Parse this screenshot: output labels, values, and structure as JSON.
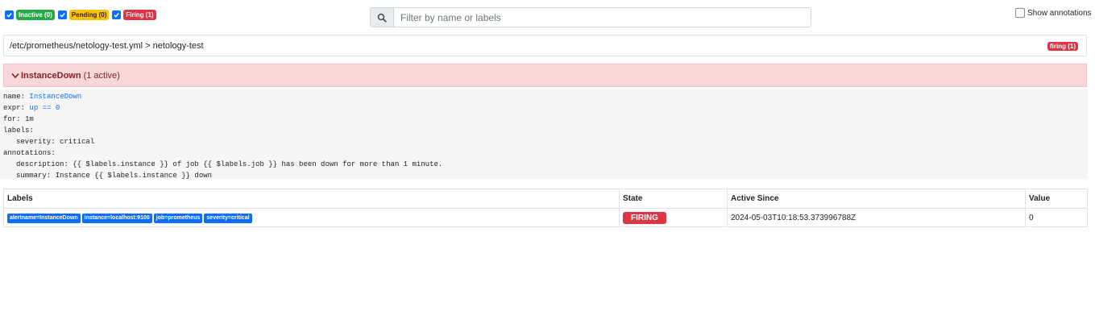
{
  "filters": {
    "inactive": {
      "label": "Inactive (0)",
      "checked": true
    },
    "pending": {
      "label": "Pending (0)",
      "checked": true
    },
    "firing": {
      "label": "Firing (1)",
      "checked": true
    }
  },
  "search": {
    "placeholder": "Filter by name or labels",
    "value": ""
  },
  "show_annotations": {
    "label": "Show annotations",
    "checked": false
  },
  "group": {
    "path": "/etc/prometheus/netology-test.yml > netology-test",
    "badge": "firing (1)"
  },
  "rule": {
    "name": "InstanceDown",
    "active": "(1 active)",
    "definition": {
      "name_key": "name:",
      "name_val": "InstanceDown",
      "expr_key": "expr:",
      "expr_val": "up == 0",
      "for_line": "for: 1m",
      "labels_key": "labels:",
      "severity_line": "severity: critical",
      "annotations_key": "annotations:",
      "description_line": "description: {{ $labels.instance }} of job {{ $labels.job }} has been down for more than 1 minute.",
      "summary_line": "summary: Instance {{ $labels.instance }} down"
    }
  },
  "alerts_table": {
    "headers": [
      "Labels",
      "State",
      "Active Since",
      "Value"
    ],
    "rows": [
      {
        "labels": [
          "alertname=InstanceDown",
          "instance=localhost:9100",
          "job=prometheus",
          "severity=critical"
        ],
        "state": "FIRING",
        "active_since": "2024-05-03T10:18:53.373996788Z",
        "value": "0"
      }
    ]
  },
  "colors": {
    "primary": "#0d6efd",
    "inactive": "#28a745",
    "pending": "#ffc107",
    "firing": "#dc3545",
    "rule_header_bg": "#f8d7da"
  }
}
